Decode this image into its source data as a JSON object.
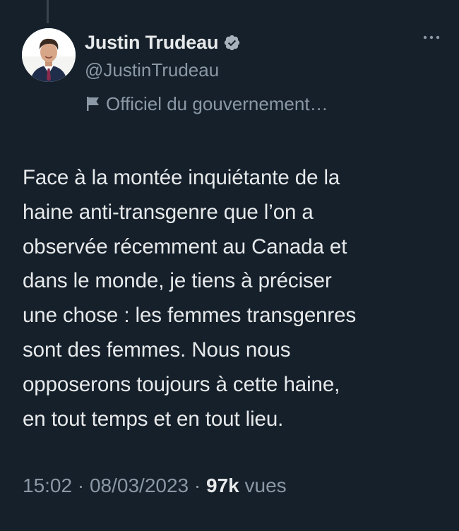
{
  "tweet": {
    "author": {
      "display_name": "Justin Trudeau",
      "handle": "@JustinTrudeau",
      "verified": true,
      "label": "Officiel du gouvernement…"
    },
    "text_lines": [
      "Face à la montée inquiétante de la",
      "haine anti-transgenre que l’on a",
      "observée récemment au Canada et",
      "dans le monde, je tiens à préciser",
      "une chose : les femmes transgenres",
      "sont des femmes. Nous nous",
      "opposerons toujours à cette haine,",
      "en tout temps et en tout lieu."
    ],
    "meta": {
      "time": "15:02",
      "separator": "·",
      "date": "08/03/2023",
      "views_count": "97k",
      "views_label": "vues"
    }
  },
  "icons": {
    "verified": "verified-badge-icon",
    "label": "flag-icon",
    "more": "more-options-icon"
  },
  "colors": {
    "background": "#15202b",
    "primary_text": "#e7e9ea",
    "secondary_text": "#8b98a5",
    "thread_line": "#38444d"
  }
}
